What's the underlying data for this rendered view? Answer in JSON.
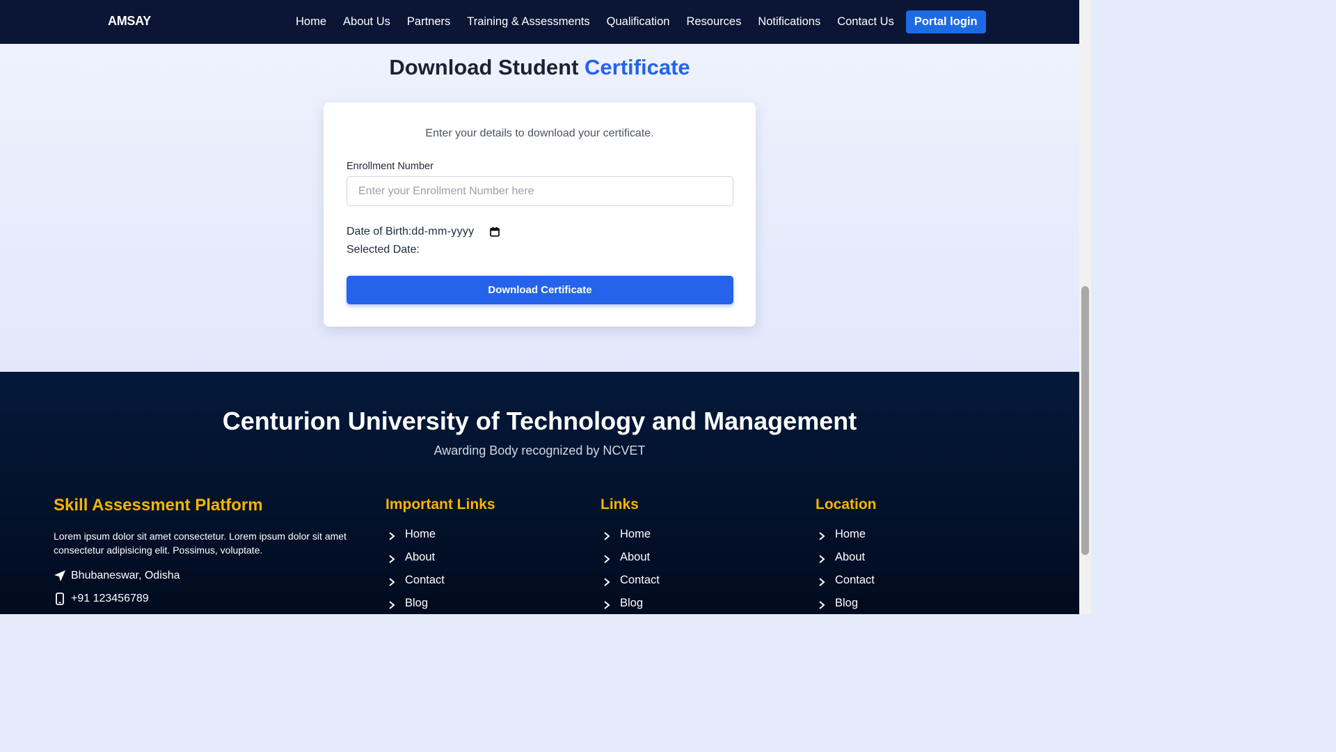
{
  "nav": {
    "brand": "AMSAY",
    "links": [
      "Home",
      "About Us",
      "Partners",
      "Training & Assessments",
      "Qualification",
      "Resources",
      "Notifications",
      "Contact Us"
    ],
    "portal_login": "Portal login"
  },
  "page": {
    "title_main": "Download Student",
    "title_accent": "Certificate"
  },
  "form": {
    "intro": "Enter your details to download your certificate.",
    "enrollment_label": "Enrollment Number",
    "enrollment_placeholder": "Enter your Enrollment Number here",
    "enrollment_value": "",
    "dob_label": "Date of Birth:",
    "dob_value": "dd-mm-yyyy",
    "selected_date_label": "Selected Date:",
    "download_button": "Download Certificate"
  },
  "footer": {
    "title": "Centurion University of Technology and Management",
    "subtitle": "Awarding Body recognized by NCVET",
    "about": {
      "heading": "Skill Assessment Platform",
      "text": "Lorem ipsum dolor sit amet consectetur. Lorem ipsum dolor sit amet consectetur adipisicing elit. Possimus, voluptate.",
      "address": "Bhubaneswar, Odisha",
      "phone": "+91 123456789"
    },
    "columns": [
      {
        "heading": "Important Links",
        "items": [
          "Home",
          "About",
          "Contact",
          "Blog"
        ]
      },
      {
        "heading": "Links",
        "items": [
          "Home",
          "About",
          "Contact",
          "Blog"
        ]
      },
      {
        "heading": "Location",
        "items": [
          "Home",
          "About",
          "Contact",
          "Blog"
        ]
      }
    ]
  },
  "colors": {
    "nav_bg": "#0b1535",
    "accent_blue": "#2563eb",
    "footer_heading": "#f7b500"
  }
}
